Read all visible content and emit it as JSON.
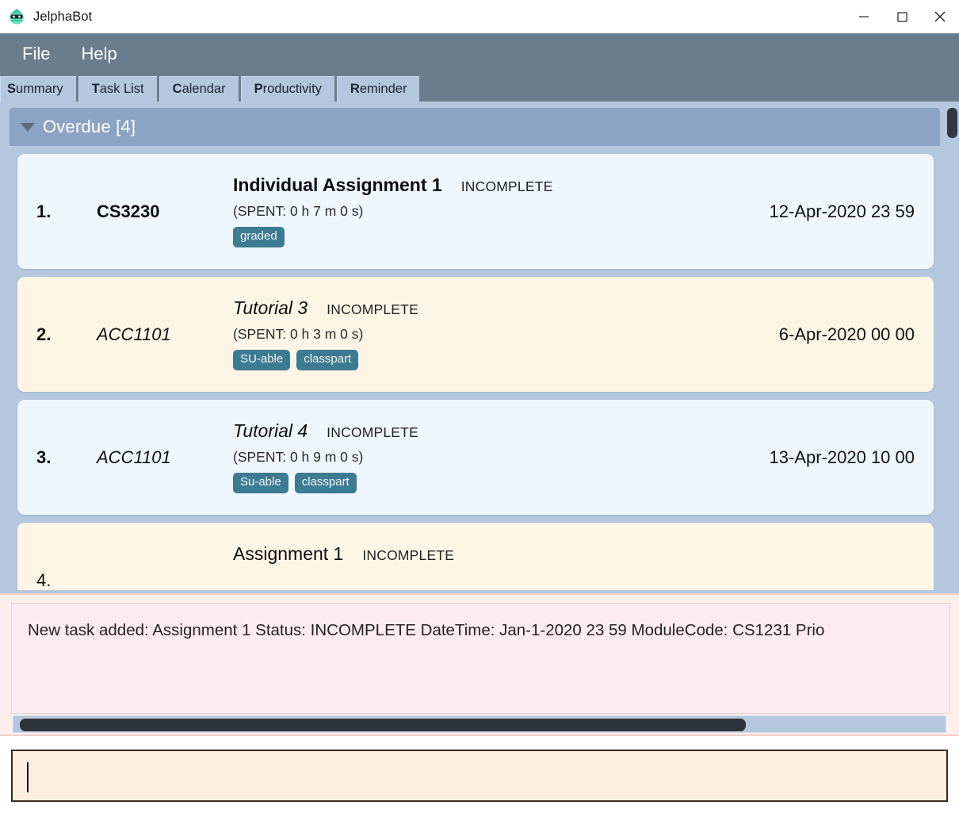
{
  "window": {
    "title": "JelphaBot",
    "icon": "app-robot-icon",
    "controls": {
      "minimize": "minimize-icon",
      "maximize": "maximize-icon",
      "close": "close-icon"
    }
  },
  "menubar": {
    "items": [
      {
        "label": "File"
      },
      {
        "label": "Help"
      }
    ]
  },
  "tabs": [
    {
      "mnemonic": "S",
      "rest": "ummary",
      "label": "Summary",
      "active": true
    },
    {
      "mnemonic": "T",
      "rest": "ask List",
      "label": "Task List",
      "active": false
    },
    {
      "mnemonic": "C",
      "rest": "alendar",
      "label": "Calendar",
      "active": false
    },
    {
      "mnemonic": "P",
      "rest": "roductivity",
      "label": "Productivity",
      "active": false
    },
    {
      "mnemonic": "R",
      "rest": "eminder",
      "label": "Reminder",
      "active": false
    }
  ],
  "section": {
    "caret": "chevron-down-icon",
    "title": "Overdue [4]",
    "count": 4
  },
  "tasks": [
    {
      "index": "1.",
      "module": "CS3230",
      "name": "Individual Assignment 1",
      "status": "INCOMPLETE",
      "spent": "(SPENT: 0 h 7 m 0 s)",
      "tags": [
        "graded"
      ],
      "date": "12-Apr-2020 23 59",
      "theme": "blue",
      "emphasis": "bold"
    },
    {
      "index": "2.",
      "module": "ACC1101",
      "name": "Tutorial 3",
      "status": "INCOMPLETE",
      "spent": "(SPENT: 0 h 3 m 0 s)",
      "tags": [
        "SU-able",
        "classpart"
      ],
      "date": "6-Apr-2020 00 00",
      "theme": "cream",
      "emphasis": "italic"
    },
    {
      "index": "3.",
      "module": "ACC1101",
      "name": "Tutorial 4",
      "status": "INCOMPLETE",
      "spent": "(SPENT: 0 h 9 m 0 s)",
      "tags": [
        "Su-able",
        "classpart"
      ],
      "date": "13-Apr-2020 10 00",
      "theme": "blue",
      "emphasis": "italic"
    },
    {
      "index": "4.",
      "module": "",
      "name": "Assignment 1",
      "status": "INCOMPLETE",
      "spent": "",
      "tags": [],
      "date": "",
      "theme": "cream",
      "emphasis": "none"
    }
  ],
  "result": {
    "text": "New task added: Assignment 1 Status: INCOMPLETE DateTime: Jan-1-2020 23 59 ModuleCode: CS1231 Prio"
  },
  "command": {
    "value": "",
    "placeholder": ""
  },
  "colors": {
    "menubar": "#6b7c8d",
    "panel": "#b5c7df",
    "section_header": "#8ba4c4",
    "card_blue": "#eef6fe",
    "card_cream": "#fdf6e7",
    "tag": "#3d7b92",
    "result_bg": "#fcebf0",
    "command_bg": "#fdeee2"
  }
}
